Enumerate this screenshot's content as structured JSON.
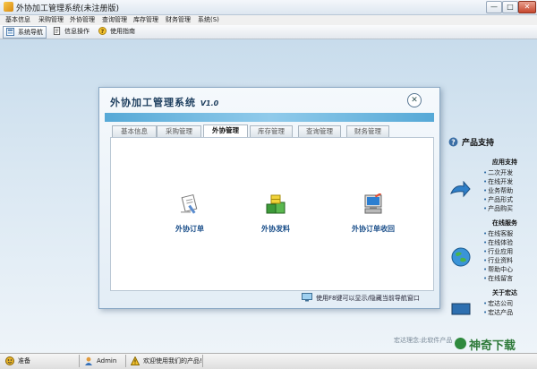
{
  "window": {
    "title": "外协加工管理系统(未注册版)",
    "buttons": {
      "minimize": "—",
      "maximize": "□",
      "close": "✕"
    }
  },
  "menubar": {
    "items": [
      {
        "label": "基本信息"
      },
      {
        "label": "采购管理"
      },
      {
        "label": "外协管理"
      },
      {
        "label": "查询管理"
      },
      {
        "label": "库存管理"
      },
      {
        "label": "财务管理"
      },
      {
        "label": "系统(S)"
      }
    ]
  },
  "toolbar": {
    "items": [
      {
        "label": "系统导航",
        "icon": "navigation-icon",
        "active": true
      },
      {
        "label": "信息操作",
        "icon": "document-icon",
        "active": false
      },
      {
        "label": "使用指南",
        "icon": "help-icon",
        "active": false
      }
    ]
  },
  "dialog": {
    "title": "外协加工管理系统",
    "version": "V1.0",
    "close": "✕",
    "tabs": [
      {
        "label": "基本信息"
      },
      {
        "label": "采购管理"
      },
      {
        "label": "外协管理",
        "active": true
      },
      {
        "label": "库存管理"
      },
      {
        "label": "查询管理"
      },
      {
        "label": "财务管理"
      }
    ],
    "functions": [
      {
        "label": "外协订单",
        "icon": "order-document-icon"
      },
      {
        "label": "外协发料",
        "icon": "material-boxes-icon"
      },
      {
        "label": "外协订单收回",
        "icon": "computer-icon"
      }
    ],
    "footer": "使用F8键可以显示/隐藏当前导航窗口"
  },
  "right_panel": {
    "heading": "产品支持",
    "sections": [
      {
        "title": "应用支持",
        "links": [
          "二次开发",
          "在线开发",
          "业务帮助",
          "产品形式",
          "产品购买"
        ]
      },
      {
        "title": "在线服务",
        "links": [
          "在线客服",
          "在线体验",
          "行业应用",
          "行业资料",
          "帮助中心",
          "在线留言"
        ]
      },
      {
        "title": "关于宏达",
        "links": [
          "宏达公司",
          "宏达产品"
        ]
      }
    ]
  },
  "statusbar": {
    "items": [
      {
        "label": "准备",
        "icon": "ready-icon"
      },
      {
        "label": "Admin",
        "icon": "user-icon"
      },
      {
        "label": "欢迎使用我们的产品!",
        "icon": "welcome-icon"
      }
    ]
  },
  "overlay": {
    "partial_text": "宏达理念:此软件产品",
    "watermark": "神奇下载"
  },
  "colors": {
    "accent": "#1b4f8a",
    "band": "#3a9bd0",
    "watermark": "#2f7a3a"
  }
}
